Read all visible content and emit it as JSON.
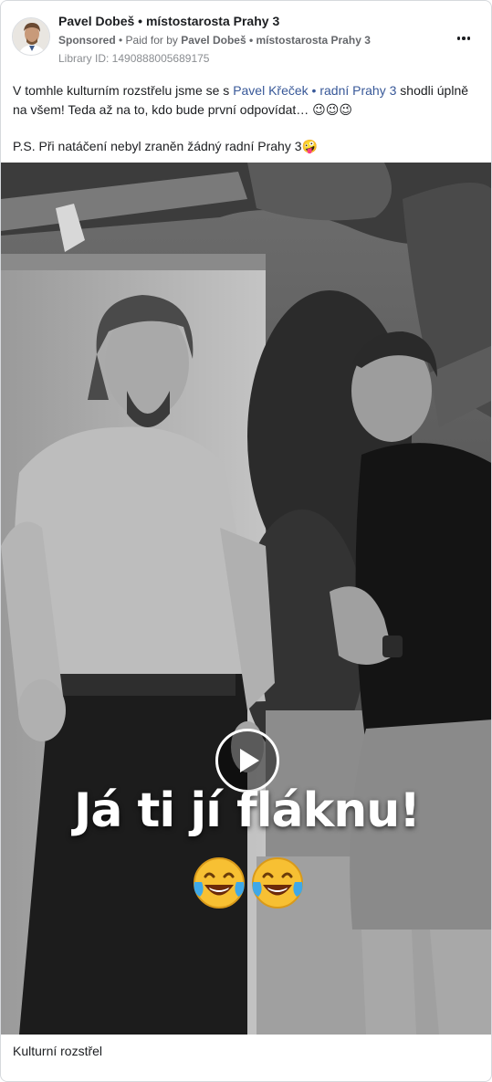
{
  "post": {
    "page_name": "Pavel Dobeš • místostarosta Prahy 3",
    "sponsored_label": "Sponsored",
    "paid_for_prefix": " • Paid for by ",
    "paid_for_by": "Pavel Dobeš • místostarosta Prahy 3",
    "library_id": "Library ID: 1490888005689175",
    "body_line1_before": "V tomhle kulturním rozstřelu jsme se s ",
    "body_mention": "Pavel Křeček • radní Prahy 3",
    "body_line1_after": " shodli úplně na všem! Teda až na to, kdo bude první odpovídat… 😉😉😉",
    "body_line2": "P.S. Při natáčení nebyl zraněn žádný radní Prahy 3🤪",
    "footer_title": "Kulturní rozstřel"
  },
  "video": {
    "caption": "Já ti jí fláknu!",
    "emoji_icons": [
      "crying-laughing-face-icon",
      "crying-laughing-face-icon"
    ]
  },
  "icons": {
    "more": "more-options-icon",
    "play": "play-icon"
  },
  "colors": {
    "mention": "#385898",
    "secondary_text": "#65676b"
  }
}
